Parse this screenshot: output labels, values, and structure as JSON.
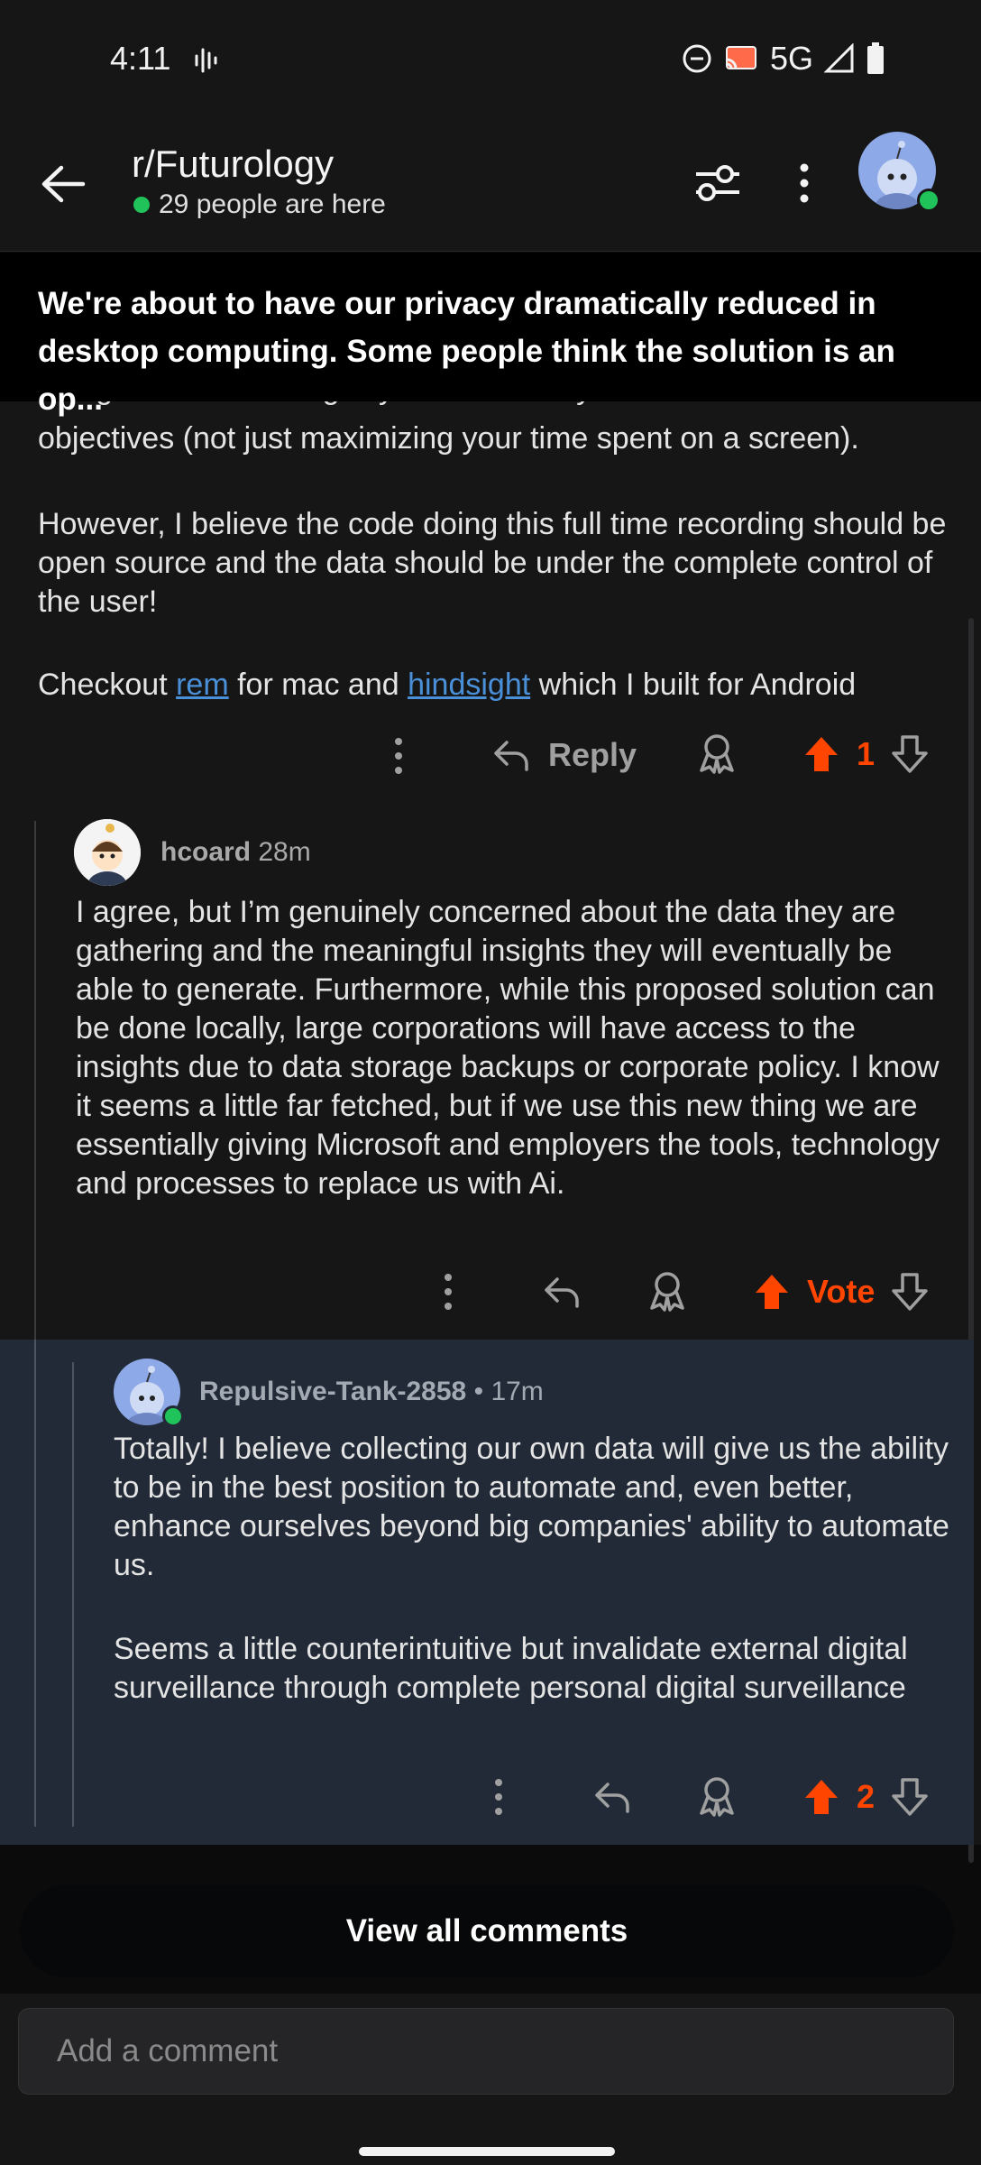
{
  "status_bar": {
    "time": "4:11",
    "network": "5G"
  },
  "header": {
    "subreddit": "r/Futurology",
    "online_text": "29 people are here"
  },
  "post": {
    "title": "We're about to have our privacy dramatically reduced in desktop computing. Some people think the solution is an op..."
  },
  "parent_comment": {
    "cut_line": "being able to meaningfully use A.I. with your own defined",
    "para1_cont": "objectives (not just maximizing your time spent on a screen).",
    "para2": "However, I believe the code doing this full time recording should be open source and the data should be under the complete control of the user!",
    "para3_prefix": "Checkout ",
    "link1": "rem",
    "para3_mid": " for mac and ",
    "link2": "hindsight",
    "para3_suffix": " which I built for Android",
    "reply_label": "Reply",
    "votes": "1"
  },
  "comment1": {
    "username": "hcoard",
    "age": "28m",
    "text": "I agree, but I’m genuinely concerned about the data they are gathering and the meaningful insights they will eventually be able to generate. Furthermore, while this proposed solution can be done locally, large corporations will have access to the insights due to data storage backups or corporate policy. I know it seems a little far fetched, but if we use this new thing we are essentially giving Microsoft and employers the tools, technology and processes to replace us with Ai.",
    "vote_label": "Vote"
  },
  "comment2": {
    "username": "Repulsive-Tank-2858",
    "age": "17m",
    "para1": "Totally! I believe collecting our own data will give us the ability to be in the best position to automate and, even better, enhance ourselves beyond big companies' ability to automate us.",
    "para2": "Seems a little counterintuitive but invalidate external digital surveillance through complete personal digital surveillance",
    "votes": "2"
  },
  "footer": {
    "view_all": "View all comments",
    "comment_placeholder": "Add a comment"
  },
  "colors": {
    "upvote": "#ff4500",
    "online": "#20c35a",
    "link": "#4a90d9"
  }
}
